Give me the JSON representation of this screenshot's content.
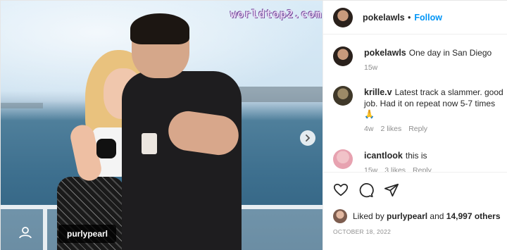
{
  "photo": {
    "watermark": "worldtop2.com",
    "tagged_user": "purlypearl"
  },
  "post": {
    "author": "pokelawls",
    "separator": "•",
    "follow_label": "Follow"
  },
  "comments": [
    {
      "user": "pokelawls",
      "text": "One day in San Diego",
      "age": "15w"
    },
    {
      "user": "krille.v",
      "text": "Latest track a slammer. good job. Had it on repeat now 5-7 times",
      "emoji": "🙏",
      "age": "4w",
      "likes": "2 likes",
      "reply_label": "Reply"
    },
    {
      "user": "icantlook",
      "text": "this is",
      "age": "15w",
      "likes": "3 likes",
      "reply_label": "Reply"
    }
  ],
  "engagement": {
    "liked_by_prefix": "Liked by",
    "liked_by_user": "purlypearl",
    "and_label": "and",
    "others": "14,997 others",
    "date": "OCTOBER 18, 2022"
  },
  "icons": {
    "like": "heart-icon",
    "comment": "comment-icon",
    "share": "share-icon",
    "next": "chevron-right-icon",
    "tag": "person-tag-icon"
  }
}
